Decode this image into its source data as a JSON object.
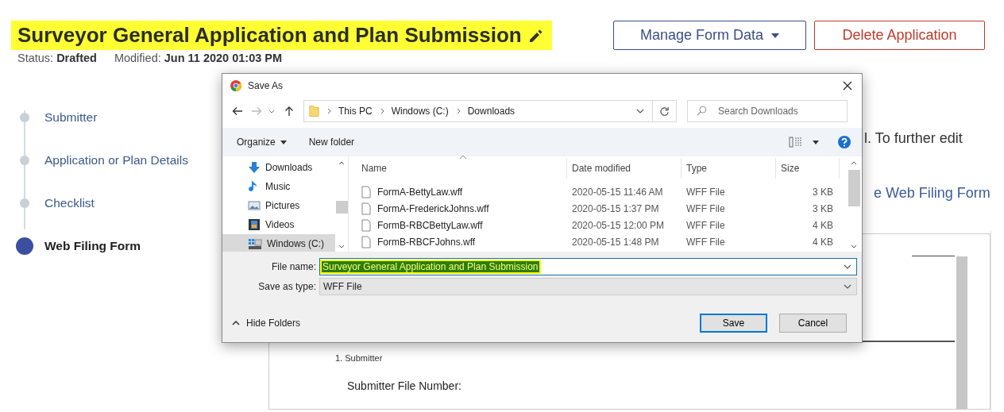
{
  "page": {
    "title": "Surveyor General Application and Plan Submission",
    "status_label": "Status:",
    "status": "Drafted",
    "modified_label": "Modified:",
    "modified": "Jun 11 2020 01:03 PM",
    "buttons": [
      {
        "label": "Manage Form Data",
        "kind": "dropdown"
      },
      {
        "label": "Delete Application",
        "kind": "danger"
      }
    ],
    "steps": [
      {
        "label": "Submitter",
        "selected": false
      },
      {
        "label": "Application or Plan Details",
        "selected": false
      },
      {
        "label": "Checklist",
        "selected": false
      },
      {
        "label": "Web Filing Form",
        "selected": true
      }
    ],
    "intro_text": "l. To further edit",
    "link": "e Web Filing Form",
    "document": {
      "section": "1. Submitter",
      "field_label": "Submitter File Number:"
    }
  },
  "dialog": {
    "title": "Save As",
    "path": [
      "This PC",
      "Windows (C:)",
      "Downloads"
    ],
    "search_placeholder": "Search Downloads",
    "toolbar": [
      "Organize",
      "New folder"
    ],
    "nav": [
      {
        "label": "Downloads",
        "kind": "downloads",
        "selected": false
      },
      {
        "label": "Music",
        "kind": "music",
        "selected": false
      },
      {
        "label": "Pictures",
        "kind": "pictures",
        "selected": false
      },
      {
        "label": "Videos",
        "kind": "videos",
        "selected": false
      },
      {
        "label": "Windows (C:)",
        "kind": "drive",
        "selected": true
      }
    ],
    "columns": [
      "Name",
      "Date modified",
      "Type",
      "Size"
    ],
    "files": [
      {
        "name": "FormA-BettyLaw.wff",
        "date": "2020-05-15 11:46 AM",
        "type": "WFF File",
        "size": "3 KB"
      },
      {
        "name": "FormA-FrederickJohns.wff",
        "date": "2020-05-15 1:37 PM",
        "type": "WFF File",
        "size": "3 KB"
      },
      {
        "name": "FormB-RBCBettyLaw.wff",
        "date": "2020-05-15 12:00 PM",
        "type": "WFF File",
        "size": "4 KB"
      },
      {
        "name": "FormB-RBCFJohns.wff",
        "date": "2020-05-15 1:48 PM",
        "type": "WFF File",
        "size": "4 KB"
      }
    ],
    "file_name_label": "File name:",
    "file_name": "Surveyor General Application and Plan Submission",
    "type_label": "Save as type:",
    "type_value": "WFF File",
    "hide_folders": "Hide Folders",
    "buttons": [
      {
        "label": "Save",
        "default": true
      },
      {
        "label": "Cancel",
        "default": false
      }
    ]
  }
}
